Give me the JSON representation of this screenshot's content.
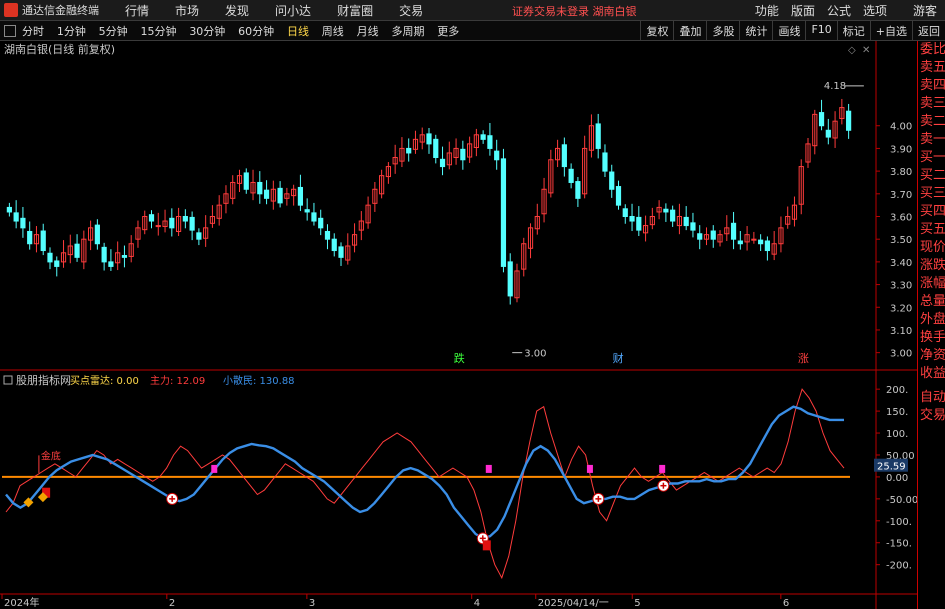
{
  "app": {
    "title": "通达信金融终端",
    "status_alert": "证券交易未登录   湖南白银"
  },
  "menu": [
    "行情",
    "市场",
    "发现",
    "问小达",
    "财富圈",
    "交易"
  ],
  "right_menu": [
    "功能",
    "版面",
    "公式",
    "选项",
    "游客"
  ],
  "periods": [
    "分时",
    "1分钟",
    "5分钟",
    "15分钟",
    "30分钟",
    "60分钟",
    "日线",
    "周线",
    "月线",
    "多周期",
    "更多"
  ],
  "active_period": "日线",
  "tools": [
    "复权",
    "叠加",
    "多股",
    "统计",
    "画线",
    "F10",
    "标记",
    "+自选",
    "返回"
  ],
  "side_panel": {
    "upper": [
      "委比",
      "卖五",
      "卖四",
      "卖三",
      "卖二",
      "卖一",
      "买一",
      "买二",
      "买三",
      "买四",
      "买五",
      "现价",
      "涨跌",
      "涨幅",
      "总量",
      "外盘",
      "换手",
      "净资",
      "收益"
    ],
    "lower": [
      "自动",
      "交易"
    ]
  },
  "colors": {
    "up": "#ff3c3c",
    "down": "#54ffff",
    "blue_line": "#3a8ee6",
    "orange_line": "#ff8a00",
    "magenta": "#ff2ad0"
  },
  "chart_data": [
    {
      "type": "candlestick",
      "title": "湖南白银(日线 前复权)",
      "ylim": [
        2.95,
        4.25
      ],
      "y_ticks": [
        "4.00",
        "3.90",
        "3.80",
        "3.70",
        "3.60",
        "3.50",
        "3.40",
        "3.30",
        "3.20",
        "3.10",
        "3.00"
      ],
      "annotations": {
        "high": "4.18",
        "low": "3.00"
      },
      "event_marks": [
        {
          "label": "跌",
          "at": 0.529,
          "color": "#3cff3c"
        },
        {
          "label": "财",
          "at": 0.715,
          "color": "#54aaff"
        },
        {
          "label": "涨",
          "at": 0.932,
          "color": "#ff4040"
        }
      ],
      "closes": [
        3.62,
        3.58,
        3.55,
        3.48,
        3.52,
        3.45,
        3.4,
        3.38,
        3.44,
        3.47,
        3.42,
        3.5,
        3.55,
        3.48,
        3.4,
        3.38,
        3.44,
        3.42,
        3.48,
        3.55,
        3.6,
        3.58,
        3.56,
        3.58,
        3.55,
        3.6,
        3.58,
        3.54,
        3.5,
        3.55,
        3.6,
        3.65,
        3.7,
        3.75,
        3.78,
        3.72,
        3.75,
        3.7,
        3.68,
        3.72,
        3.66,
        3.7,
        3.72,
        3.65,
        3.62,
        3.58,
        3.55,
        3.5,
        3.45,
        3.42,
        3.47,
        3.52,
        3.58,
        3.65,
        3.72,
        3.78,
        3.82,
        3.86,
        3.9,
        3.88,
        3.94,
        3.96,
        3.92,
        3.86,
        3.82,
        3.88,
        3.9,
        3.85,
        3.92,
        3.96,
        3.94,
        3.9,
        3.85,
        3.38,
        3.25,
        3.36,
        3.48,
        3.55,
        3.6,
        3.72,
        3.85,
        3.9,
        3.82,
        3.75,
        3.68,
        3.9,
        4.0,
        3.9,
        3.8,
        3.72,
        3.65,
        3.6,
        3.58,
        3.54,
        3.56,
        3.6,
        3.64,
        3.62,
        3.58,
        3.6,
        3.56,
        3.54,
        3.5,
        3.52,
        3.5,
        3.52,
        3.55,
        3.5,
        3.48,
        3.52,
        3.5,
        3.48,
        3.45,
        3.48,
        3.55,
        3.6,
        3.65,
        3.82,
        3.92,
        4.05,
        4.0,
        3.95,
        4.02,
        4.08,
        3.98
      ]
    },
    {
      "type": "line",
      "title": "股朋指标网",
      "legend": [
        {
          "label": "买点雷达: 0.00",
          "color": "#ffd84a"
        },
        {
          "label": "主力: 12.09",
          "color": "#ff3c3c"
        },
        {
          "label": "小散民: 130.88",
          "color": "#3a8ee6"
        }
      ],
      "ylim": [
        -260,
        230
      ],
      "y_ticks": [
        "200.",
        "150.",
        "100.",
        "50.00",
        "0.00",
        "-50.00",
        "-100.",
        "-150.",
        "-200."
      ],
      "y_tick_values": [
        200,
        150,
        100,
        50,
        0,
        -50,
        -100,
        -150,
        -200
      ],
      "current_value": "25.59",
      "x_ticks": [
        {
          "label": "2024年",
          "at": 0.0
        },
        {
          "label": "2",
          "at": 0.193
        },
        {
          "label": "3",
          "at": 0.357
        },
        {
          "label": "4",
          "at": 0.55
        },
        {
          "label": "2025/04/14/一",
          "at": 0.625
        },
        {
          "label": "5",
          "at": 0.738
        },
        {
          "label": "6",
          "at": 0.912
        }
      ],
      "series": [
        {
          "name": "主力",
          "color": "#ff3c3c",
          "values": [
            -80,
            -60,
            -20,
            -10,
            0,
            10,
            20,
            30,
            20,
            10,
            0,
            20,
            40,
            60,
            50,
            30,
            40,
            30,
            20,
            10,
            0,
            -10,
            0,
            20,
            50,
            70,
            60,
            40,
            20,
            30,
            40,
            50,
            40,
            20,
            0,
            -20,
            -40,
            -30,
            -10,
            10,
            30,
            20,
            10,
            0,
            -10,
            -30,
            -50,
            -60,
            -40,
            -20,
            0,
            20,
            40,
            60,
            80,
            90,
            100,
            90,
            80,
            60,
            40,
            20,
            0,
            10,
            20,
            10,
            0,
            -30,
            -80,
            -150,
            -200,
            -230,
            -180,
            -100,
            0,
            80,
            150,
            160,
            100,
            50,
            0,
            40,
            70,
            50,
            -20,
            -80,
            -100,
            -60,
            -20,
            0,
            20,
            0,
            -10,
            0,
            10,
            -10,
            -30,
            -20,
            -10,
            0,
            10,
            0,
            -10,
            0,
            10,
            20,
            10,
            0,
            10,
            20,
            10,
            30,
            80,
            150,
            200,
            180,
            150,
            100,
            60,
            40,
            20
          ]
        },
        {
          "name": "小散民",
          "color": "#3a8ee6",
          "values": [
            -40,
            -60,
            -70,
            -60,
            -40,
            -20,
            0,
            15,
            25,
            35,
            40,
            45,
            50,
            45,
            40,
            30,
            20,
            10,
            0,
            -10,
            -20,
            -30,
            -40,
            -50,
            -55,
            -50,
            -40,
            -20,
            0,
            20,
            40,
            55,
            65,
            70,
            75,
            72,
            70,
            65,
            55,
            45,
            35,
            20,
            10,
            0,
            -10,
            -25,
            -40,
            -55,
            -70,
            -80,
            -75,
            -60,
            -40,
            -20,
            0,
            15,
            20,
            15,
            5,
            -5,
            -20,
            -40,
            -70,
            -90,
            -110,
            -130,
            -140,
            -135,
            -120,
            -90,
            -50,
            -10,
            30,
            60,
            70,
            60,
            40,
            10,
            -20,
            -50,
            -60,
            -55,
            -50,
            -50,
            -45,
            -45,
            -50,
            -50,
            -40,
            -30,
            -25,
            -20,
            -15,
            -15,
            -10,
            -10,
            -10,
            -5,
            -10,
            -10,
            -5,
            -5,
            10,
            30,
            60,
            90,
            120,
            140,
            150,
            160,
            155,
            145,
            140,
            135,
            130,
            130,
            130
          ]
        },
        {
          "name": "0轴",
          "color": "#ff8a00",
          "values": [
            0,
            0
          ]
        }
      ],
      "labels": [
        {
          "text": "金底",
          "series": "主力"
        }
      ]
    }
  ]
}
